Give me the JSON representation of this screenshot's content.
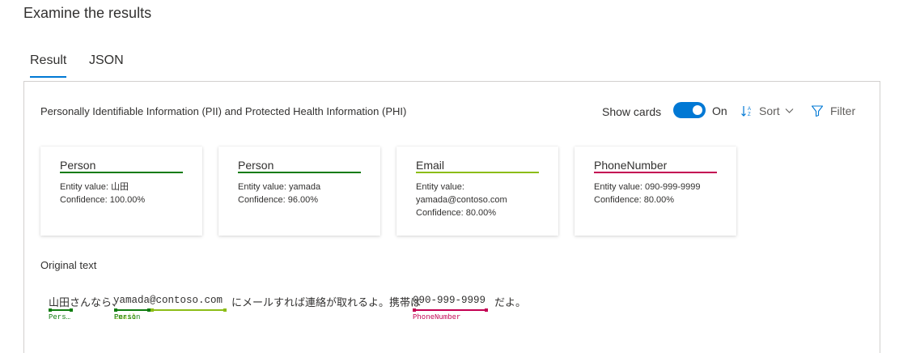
{
  "page": {
    "title": "Examine the results"
  },
  "tabs": [
    {
      "label": "Result",
      "active": true
    },
    {
      "label": "JSON",
      "active": false
    }
  ],
  "panel": {
    "title": "Personally Identifiable Information (PII) and Protected Health Information (PHI)",
    "show_cards_label": "Show cards",
    "toggle_state": "On",
    "toggle_on": true,
    "sort_label": "Sort",
    "filter_label": "Filter",
    "sort_icon": "sort-ascending-icon",
    "filter_icon": "funnel-icon"
  },
  "cards": [
    {
      "type": "Person",
      "color": "#107c10",
      "lines": [
        "Entity value: 山田",
        "Confidence: 100.00%"
      ]
    },
    {
      "type": "Person",
      "color": "#107c10",
      "lines": [
        "Entity value: yamada",
        "Confidence: 96.00%"
      ]
    },
    {
      "type": "Email",
      "color": "#8cbd18",
      "lines": [
        "Entity value:",
        "yamada@contoso.com",
        "Confidence: 80.00%"
      ]
    },
    {
      "type": "PhoneNumber",
      "color": "#c30052",
      "lines": [
        "Entity value: 090-999-9999",
        "Confidence: 80.00%"
      ]
    }
  ],
  "original_text": {
    "title": "Original text",
    "segments": [
      "山田",
      "さんなら、",
      "yamada@contoso.com",
      "にメールすれば連絡が取れるよ。携帯は",
      "090-999-9999",
      "だよ。"
    ],
    "tags": {
      "person1": "Pers…",
      "person2": "Person",
      "email": "Email",
      "phone": "PhoneNumber"
    }
  }
}
